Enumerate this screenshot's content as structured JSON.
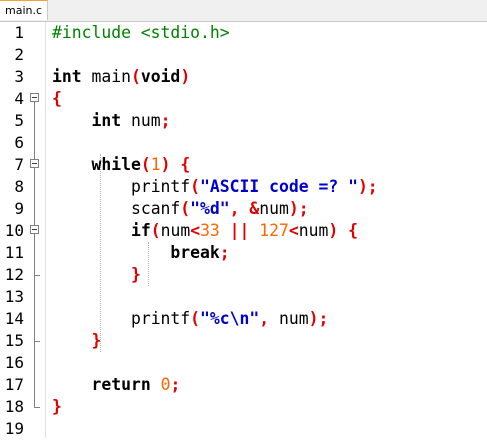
{
  "tab": {
    "label": "main.c"
  },
  "line_numbers": [
    "1",
    "2",
    "3",
    "4",
    "5",
    "6",
    "7",
    "8",
    "9",
    "10",
    "11",
    "12",
    "13",
    "14",
    "15",
    "16",
    "17",
    "18",
    "19"
  ],
  "code": {
    "l1": {
      "a": "#include <stdio.h>"
    },
    "l3": {
      "a": "int",
      "b": " main",
      "c": "(",
      "d": "void",
      "e": ")"
    },
    "l4": {
      "a": "{"
    },
    "l5": {
      "a": "int",
      "b": " num",
      "c": ";"
    },
    "l7": {
      "a": "while",
      "b": "(",
      "c": "1",
      "d": ")",
      "e": " {"
    },
    "l8": {
      "a": "printf",
      "b": "(",
      "c": "\"ASCII code =? \"",
      "d": ");"
    },
    "l9": {
      "a": "scanf",
      "b": "(",
      "c": "\"%d\"",
      "d": ", &",
      "e": "num",
      "f": ");"
    },
    "l10": {
      "a": "if",
      "b": "(",
      "c": "num",
      "d": "<",
      "e": "33",
      "f": " || ",
      "g": "127",
      "h": "<",
      "i": "num",
      "j": ")",
      "k": " {"
    },
    "l11": {
      "a": "break",
      "b": ";"
    },
    "l12": {
      "a": "}"
    },
    "l14": {
      "a": "printf",
      "b": "(",
      "c": "\"%c\\n\"",
      "d": ",",
      "e": " num",
      "f": ");"
    },
    "l15": {
      "a": "}"
    },
    "l17": {
      "a": "return",
      "b": " 0",
      "c": ";"
    },
    "l18": {
      "a": "}"
    }
  },
  "colors": {
    "keyword": "#000000",
    "preprocessor": "#008000",
    "string": "#0000cc",
    "number": "#ff6600",
    "operator": "#e00000"
  }
}
